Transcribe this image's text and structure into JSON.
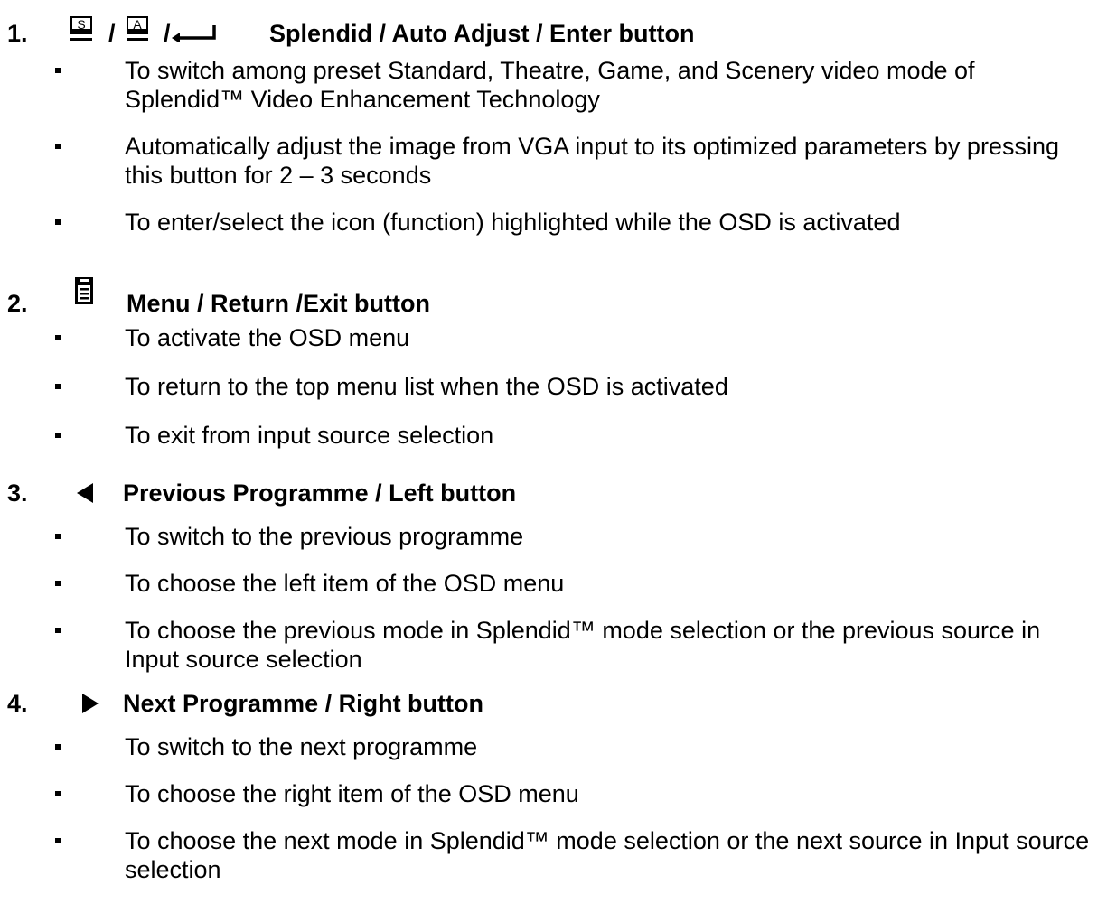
{
  "sections": [
    {
      "number": "1.",
      "icons": [
        "splendid-s-icon",
        "auto-adjust-a-icon",
        "enter-arrow-icon"
      ],
      "icon_letters": [
        "S",
        "A"
      ],
      "separators": [
        "/",
        "/"
      ],
      "title": "Splendid / Auto Adjust / Enter button",
      "bullets": [
        "To switch among preset Standard, Theatre, Game, and Scenery video mode of Splendid™ Video Enhancement Technology",
        "Automatically adjust the image from VGA input to its optimized parameters by pressing this button for 2 – 3 seconds",
        "To enter/select the icon (function) highlighted while the OSD is activated"
      ]
    },
    {
      "number": "2.",
      "icons": [
        "menu-icon"
      ],
      "title": "Menu / Return /Exit button",
      "bullets": [
        "To activate the OSD menu",
        "To return to the top menu list when the OSD is activated",
        "To exit from input source selection"
      ]
    },
    {
      "number": "3.",
      "icons": [
        "left-triangle-icon"
      ],
      "title": "Previous Programme / Left button",
      "bullets": [
        "To switch to the previous programme",
        "To choose the left item of the OSD menu",
        "To choose the previous mode in Splendid™ mode selection or the previous source in Input source selection"
      ]
    },
    {
      "number": "4.",
      "icons": [
        "right-triangle-icon"
      ],
      "title": "Next Programme / Right button",
      "bullets": [
        "To switch to the next programme",
        "To choose the right item of the OSD menu",
        "To choose the next mode in Splendid™ mode selection or the next source in Input source selection"
      ]
    }
  ]
}
